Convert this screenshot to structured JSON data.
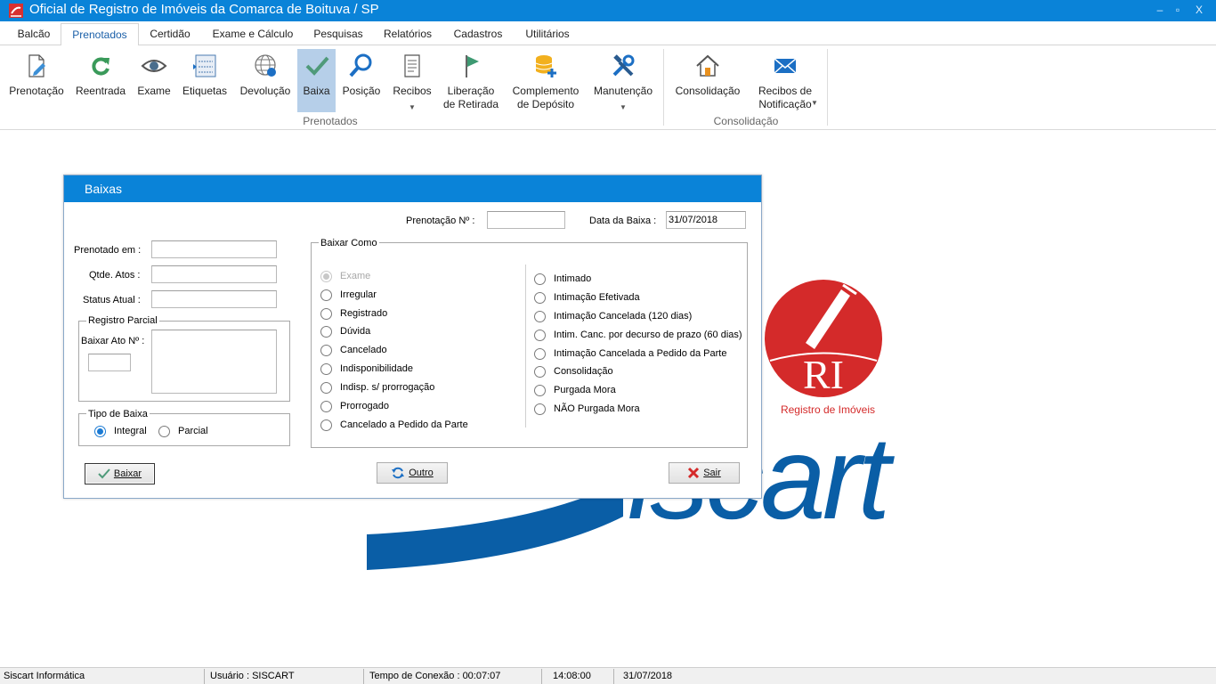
{
  "window": {
    "title": "Oficial de Registro de Imóveis da Comarca de Boituva / SP",
    "minimize": "‒",
    "restore": "▫",
    "close": "X"
  },
  "menu_tabs": [
    "Balcão",
    "Prenotados",
    "Certidão",
    "Exame e Cálculo",
    "Pesquisas",
    "Relatórios",
    "Cadastros",
    "Utilitários"
  ],
  "active_tab": "Prenotados",
  "ribbon": {
    "buttons": [
      {
        "label": "Prenotação",
        "icon": "page-edit-icon"
      },
      {
        "label": "Reentrada",
        "icon": "refresh-icon"
      },
      {
        "label": "Exame",
        "icon": "eye-icon"
      },
      {
        "label": "Etiquetas",
        "icon": "labels-icon"
      },
      {
        "label": "Devolução",
        "icon": "globe-icon"
      },
      {
        "label": "Baixa",
        "icon": "check-icon"
      },
      {
        "label": "Posição",
        "icon": "magnifier-icon"
      },
      {
        "label": "Recibos",
        "icon": "receipt-icon"
      },
      {
        "label": "Liberação",
        "label2": "de Retirada",
        "icon": "flag-icon"
      },
      {
        "label": "Complemento",
        "label2": "de Depósito",
        "icon": "database-add-icon"
      },
      {
        "label": "Manutenção",
        "icon": "tools-icon"
      },
      {
        "label": "Consolidação",
        "icon": "house-icon"
      },
      {
        "label": "Recibos de",
        "label2": "Notificação",
        "icon": "envelope-icon"
      }
    ],
    "groups": [
      "Prenotados",
      "Consolidação"
    ]
  },
  "dialog": {
    "title": "Baixas",
    "prenotacao_label": "Prenotação Nº :",
    "prenotacao_value": "",
    "data_baixa_label": "Data da Baixa :",
    "data_baixa_value": "31/07/2018",
    "prenotado_em_label": "Prenotado em :",
    "qtde_atos_label": "Qtde. Atos :",
    "status_atual_label": "Status Atual :",
    "registro_parcial": {
      "legend": "Registro Parcial",
      "baixar_ato_label": "Baixar Ato Nº :"
    },
    "tipo_baixa": {
      "legend": "Tipo de Baixa",
      "options": [
        "Integral",
        "Parcial"
      ],
      "selected": "Integral"
    },
    "baixar_como": {
      "legend": "Baixar Como",
      "left": [
        "Exame",
        "Irregular",
        "Registrado",
        "Dúvida",
        "Cancelado",
        "Indisponibilidade",
        "Indisp. s/ prorrogação",
        "Prorrogado",
        "Cancelado a Pedido da Parte"
      ],
      "right": [
        "Intimado",
        "Intimação Efetivada",
        "Intimação Cancelada (120 dias)",
        "Intim. Canc. por decurso de prazo (60 dias)",
        "Intimação Cancelada a Pedido da Parte",
        "Consolidação",
        "Purgada Mora",
        "NÃO Purgada Mora"
      ],
      "disabled": "Exame"
    },
    "buttons": {
      "baixar": "Baixar",
      "outro": "Outro",
      "sair": "Sair"
    }
  },
  "logo": {
    "ri": "RI",
    "caption": "Registro de Imóveis",
    "brand": "iscart"
  },
  "statusbar": [
    "Siscart Informática",
    "Usuário : SISCART",
    "Tempo de Conexão : 00:07:07",
    "14:08:00",
    "31/07/2018"
  ],
  "colors": {
    "accent": "#0a83d8",
    "logo_red": "#d42a2a",
    "logo_blue": "#0a5ea6"
  }
}
